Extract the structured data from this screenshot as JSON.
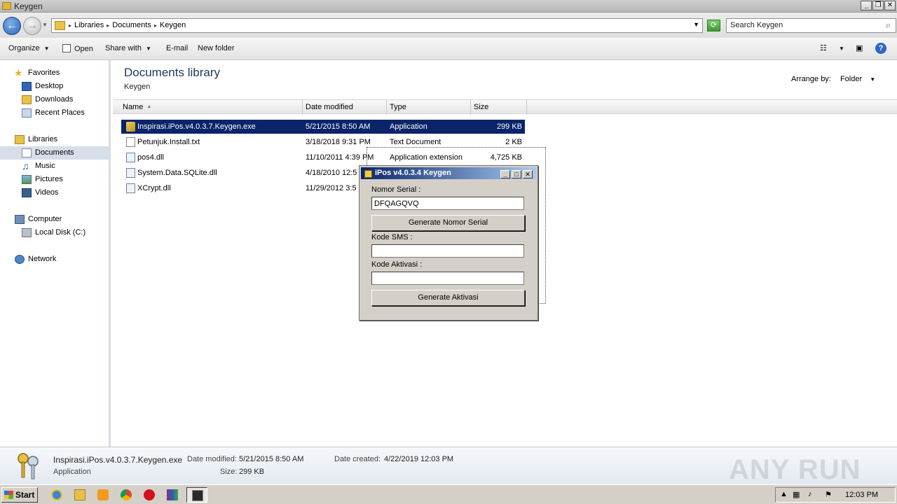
{
  "window": {
    "title": "Keygen"
  },
  "address": {
    "crumbs": [
      "Libraries",
      "Documents",
      "Keygen"
    ],
    "search_placeholder": "Search Keygen"
  },
  "toolbar": {
    "organize": "Organize",
    "open": "Open",
    "share_with": "Share with",
    "email": "E-mail",
    "new_folder": "New folder"
  },
  "nav": {
    "favorites": "Favorites",
    "desktop": "Desktop",
    "downloads": "Downloads",
    "recent_places": "Recent Places",
    "libraries": "Libraries",
    "documents": "Documents",
    "music": "Music",
    "pictures": "Pictures",
    "videos": "Videos",
    "computer": "Computer",
    "local_disk": "Local Disk (C:)",
    "network": "Network"
  },
  "content": {
    "title": "Documents library",
    "subtitle": "Keygen",
    "arrange_label": "Arrange by:",
    "arrange_value": "Folder",
    "columns": {
      "name": "Name",
      "date": "Date modified",
      "type": "Type",
      "size": "Size"
    },
    "files": [
      {
        "name": "Inspirasi.iPos.v4.0.3.7.Keygen.exe",
        "date": "5/21/2015 8:50 AM",
        "type": "Application",
        "size": "299 KB",
        "icon": "exe-keys-icon"
      },
      {
        "name": "Petunjuk.Install.txt",
        "date": "3/18/2018 9:31 PM",
        "type": "Text Document",
        "size": "2 KB",
        "icon": "text-file-icon"
      },
      {
        "name": "pos4.dll",
        "date": "11/10/2011 4:39 PM",
        "type": "Application extension",
        "size": "4,725 KB",
        "icon": "dll-file-icon"
      },
      {
        "name": "System.Data.SQLite.dll",
        "date": "4/18/2010 12:5",
        "type": "",
        "size": "",
        "icon": "dll-file-icon"
      },
      {
        "name": "XCrypt.dll",
        "date": "11/29/2012 3:5",
        "type": "",
        "size": "",
        "icon": "dll-file-icon"
      }
    ]
  },
  "keygen": {
    "title": "iPos v4.0.3.4 Keygen",
    "serial_label": "Nomor Serial :",
    "serial_value": "DFQAGQVQ",
    "generate_serial": "Generate Nomor Serial",
    "sms_label": "Kode SMS :",
    "sms_value": "",
    "activation_label": "Kode Aktivasi :",
    "activation_value": "",
    "generate_activation": "Generate Aktivasi"
  },
  "details": {
    "filename": "Inspirasi.iPos.v4.0.3.7.Keygen.exe",
    "filetype": "Application",
    "date_modified_label": "Date modified:",
    "date_modified": "5/21/2015 8:50 AM",
    "date_created_label": "Date created:",
    "date_created": "4/22/2019 12:03 PM",
    "size_label": "Size:",
    "size": "299 KB",
    "watermark": "ANY RUN"
  },
  "taskbar": {
    "start": "Start",
    "clock": "12:03 PM"
  }
}
